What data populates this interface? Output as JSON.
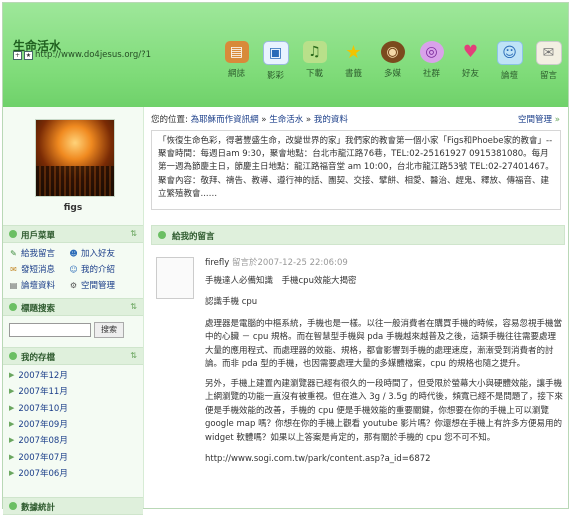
{
  "header": {
    "site_title": "生命活水",
    "site_url": "http://www.do4jesus.org/?1",
    "nav": [
      {
        "label": "網誌",
        "icon": "book-icon"
      },
      {
        "label": "影彩",
        "icon": "photo-icon"
      },
      {
        "label": "下載",
        "icon": "music-icon"
      },
      {
        "label": "書籤",
        "icon": "star-icon"
      },
      {
        "label": "多媒",
        "icon": "film-icon"
      },
      {
        "label": "社群",
        "icon": "spiral-icon"
      },
      {
        "label": "好友",
        "icon": "heart-icon"
      },
      {
        "label": "論壇",
        "icon": "forum-icon"
      },
      {
        "label": "留言",
        "icon": "guestbook-icon"
      }
    ]
  },
  "sidebar": {
    "username": "figs",
    "user_menu_title": "用戶菜單",
    "user_menu": [
      {
        "label": "給我留言",
        "icon": "message-icon"
      },
      {
        "label": "加入好友",
        "icon": "add-friend-icon"
      },
      {
        "label": "發短消息",
        "icon": "mail-icon"
      },
      {
        "label": "我的介紹",
        "icon": "profile-icon"
      },
      {
        "label": "論壇資料",
        "icon": "forum-data-icon"
      },
      {
        "label": "空間管理",
        "icon": "settings-icon"
      }
    ],
    "search_title": "標題搜索",
    "search_button": "搜索",
    "archive_title": "我的存檔",
    "archive": [
      "2007年12月",
      "2007年11月",
      "2007年10月",
      "2007年09月",
      "2007年08月",
      "2007年07月",
      "2007年06月"
    ],
    "stats_title": "數據統計"
  },
  "breadcrumb": {
    "prefix": "您的位置:",
    "crumbs": [
      "為耶穌而作資訊網",
      "生命活水",
      "我的資料"
    ],
    "separator": "»",
    "space_mgmt": "空間管理"
  },
  "intro": "「恢復生命色彩，得著豐盛生命，改變世界的家」我們家的教會第一個小家「Figs和Phoebe家的教會」--聚會時間：每週日am 9:30，聚會地點：台北市龍江路76巷，TEL:02-25161927 0915381080。每月第一週為節慶主日，節慶主日地點：龍江路福音堂 am 10:00，台北市龍江路53號 TEL:02-27401467。聚會內容：敬拜、禱告、教導、遵行神的話、團契、交接、擘餅、相愛、醫治、趕鬼、釋放、傳福音、建立繁殖教會...…",
  "messages": {
    "title": "給我的留言",
    "post": {
      "author": "firefly",
      "meta": "留言於2007-12-25 22:06:09",
      "title": "手機達人必備知識　手機cpu效能大揭密",
      "subtitle": "認識手機 cpu",
      "para1": "處理器是電腦的中樞系統，手機也是一樣。以往一般消費者在購買手機的時候，容易忽視手機當中的心臟 － cpu 規格。而在智慧型手機與 pda 手機越來越普及之後，這類手機往往需要處理大量的應用程式、而處理器的效能、規格，都會影響到手機的處理速度，漸漸受到消費者的討論。而非 pda 型的手機，也因需要處理大量的多媒體檔案，cpu 的規格也隨之提升。",
      "para2": "另外，手機上建置內建瀏覽器已經有很久的一段時間了，但受限於螢幕大小與硬體效能，讓手機上網瀏覽的功能一直沒有被重視。但在進入 3g / 3.5g 的時代後，頻寬已經不是問題了，接下來便是手機效能的改善，手機的 cpu 便是手機效能的重要關鍵，你想要在你的手機上可以瀏覽 google map 嗎？你想在你的手機上觀看 youtube 影片嗎？你還想在手機上有許多方便易用的 widget 軟體嗎？如果以上答案是肯定的，那有關於手機的 cpu 您不可不知。",
      "link": "http://www.sogi.com.tw/park/content.asp?a_id=6872"
    }
  }
}
